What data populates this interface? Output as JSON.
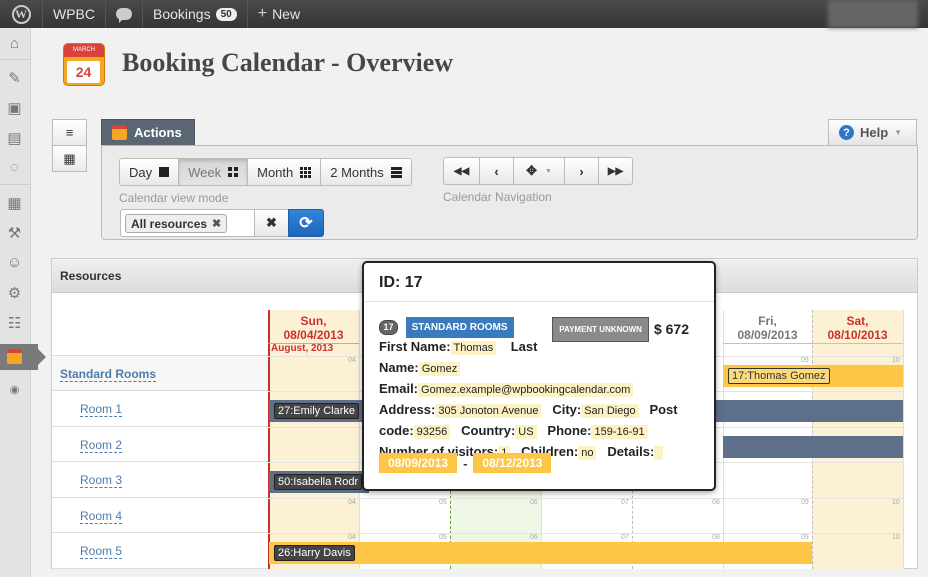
{
  "adminbar": {
    "site_name": "WPBC",
    "bookings_label": "Bookings",
    "bookings_count": "50",
    "new_label": "New",
    "wp_logo_letter": "W"
  },
  "page": {
    "title": "Booking Calendar - Overview",
    "icon_month": "MARCH",
    "icon_day": "24"
  },
  "toolbar": {
    "actions_label": "Actions",
    "help_label": "Help",
    "view_buttons": [
      "Day",
      "Week",
      "Month",
      "2 Months"
    ],
    "view_mode_label": "Calendar view mode",
    "navigation_label": "Calendar Navigation",
    "resource_chip": "All resources"
  },
  "timeline": {
    "title": "Resources",
    "resources": [
      "Standard Rooms",
      "Room 1",
      "Room 2",
      "Room 3",
      "Room 4",
      "Room 5"
    ],
    "month_label": "August, 2013",
    "days": [
      {
        "dow": "Sun,",
        "date": "08/04/2013",
        "weekend": true
      },
      {
        "dow": "Fri,",
        "date": "08/09/2013",
        "weekend": false
      },
      {
        "dow": "Sat,",
        "date": "08/10/2013",
        "weekend": true
      }
    ],
    "hour_labels": [
      "04",
      "05",
      "06",
      "07",
      "08",
      "09",
      "10"
    ],
    "bookings": [
      {
        "label": "17:Thomas Gomez",
        "row": "Standard Rooms"
      },
      {
        "label": "27:Emily Clarke",
        "row": "Room 1"
      },
      {
        "label": "50:Isabella Rodr",
        "row": "Room 3"
      },
      {
        "label": "26:Harry Davis",
        "row": "Room 5"
      }
    ]
  },
  "popover": {
    "title": "ID: 17",
    "id_badge": "17",
    "room_badge": "STANDARD ROOMS",
    "payment_badge": "PAYMENT UNKNOWN",
    "price": "$ 672",
    "first_name_label": "First Name:",
    "first_name": "Thomas",
    "last_name_label_1": "Last",
    "last_name_label_2": "Name:",
    "last_name": "Gomez",
    "email_label": "Email:",
    "email": "Gomez.example@wpbookingcalendar.com",
    "address_label": "Address:",
    "address": "305 Jonoton Avenue",
    "city_label": "City:",
    "city": "San Diego",
    "post_label_1": "Post",
    "post_label_2": "code:",
    "post_code": "93256",
    "country_label": "Country:",
    "country": "US",
    "phone_label": "Phone:",
    "phone": "159-16-91",
    "visitors_label": "Number of visitors:",
    "visitors": "1",
    "children_label": "Children:",
    "children": "no",
    "details_label": "Details:",
    "date_from": "08/09/2013",
    "date_to": "08/12/2013"
  }
}
